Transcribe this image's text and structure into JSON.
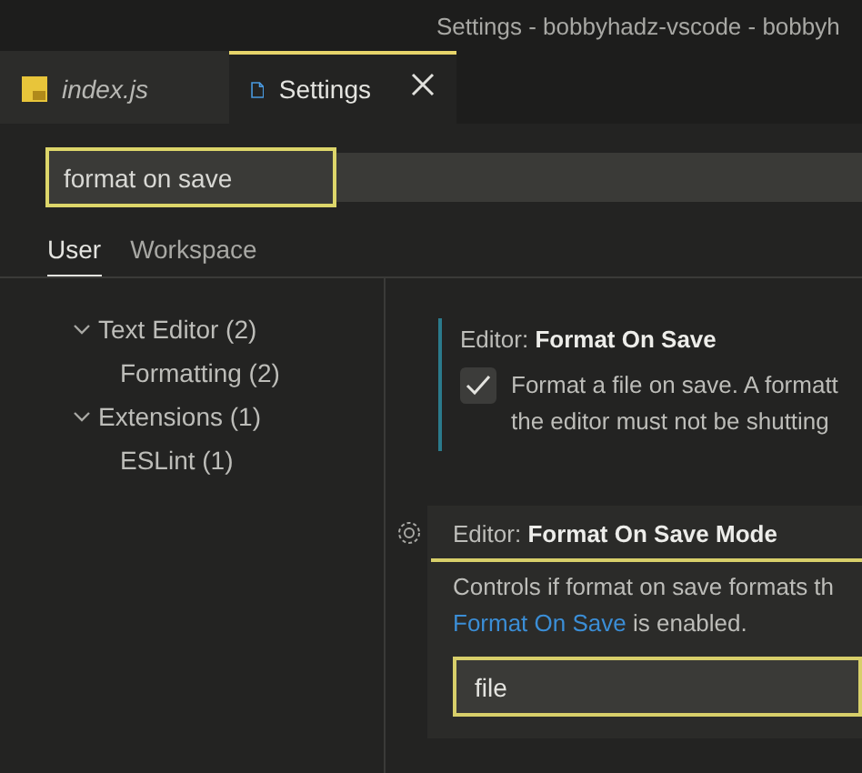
{
  "window": {
    "title": "Settings - bobbyhadz-vscode - bobbyh"
  },
  "editor_tabs": [
    {
      "label": "index.js",
      "kind": "js",
      "selected": false,
      "italic": true
    },
    {
      "label": "Settings",
      "kind": "settings",
      "selected": true,
      "italic": false
    }
  ],
  "search": {
    "value": "format on save"
  },
  "scope_tabs": [
    {
      "label": "User",
      "selected": true
    },
    {
      "label": "Workspace",
      "selected": false
    }
  ],
  "tree": [
    {
      "label": "Text Editor (2)",
      "expanded": true,
      "children": [
        {
          "label": "Formatting (2)"
        }
      ]
    },
    {
      "label": "Extensions (1)",
      "expanded": true,
      "children": [
        {
          "label": "ESLint (1)"
        }
      ]
    }
  ],
  "settings": [
    {
      "kind": "checkbox",
      "category": "Editor: ",
      "name": "Format On Save",
      "checked": true,
      "focused": false,
      "lines": [
        "Format a file on save. A formatt",
        "the editor must not be shutting"
      ]
    },
    {
      "kind": "dropdown",
      "category": "Editor: ",
      "name": "Format On Save Mode",
      "focused": true,
      "before": "Controls if format on save formats th",
      "link": "Format On Save",
      "after": " is enabled.",
      "value": "file"
    }
  ]
}
